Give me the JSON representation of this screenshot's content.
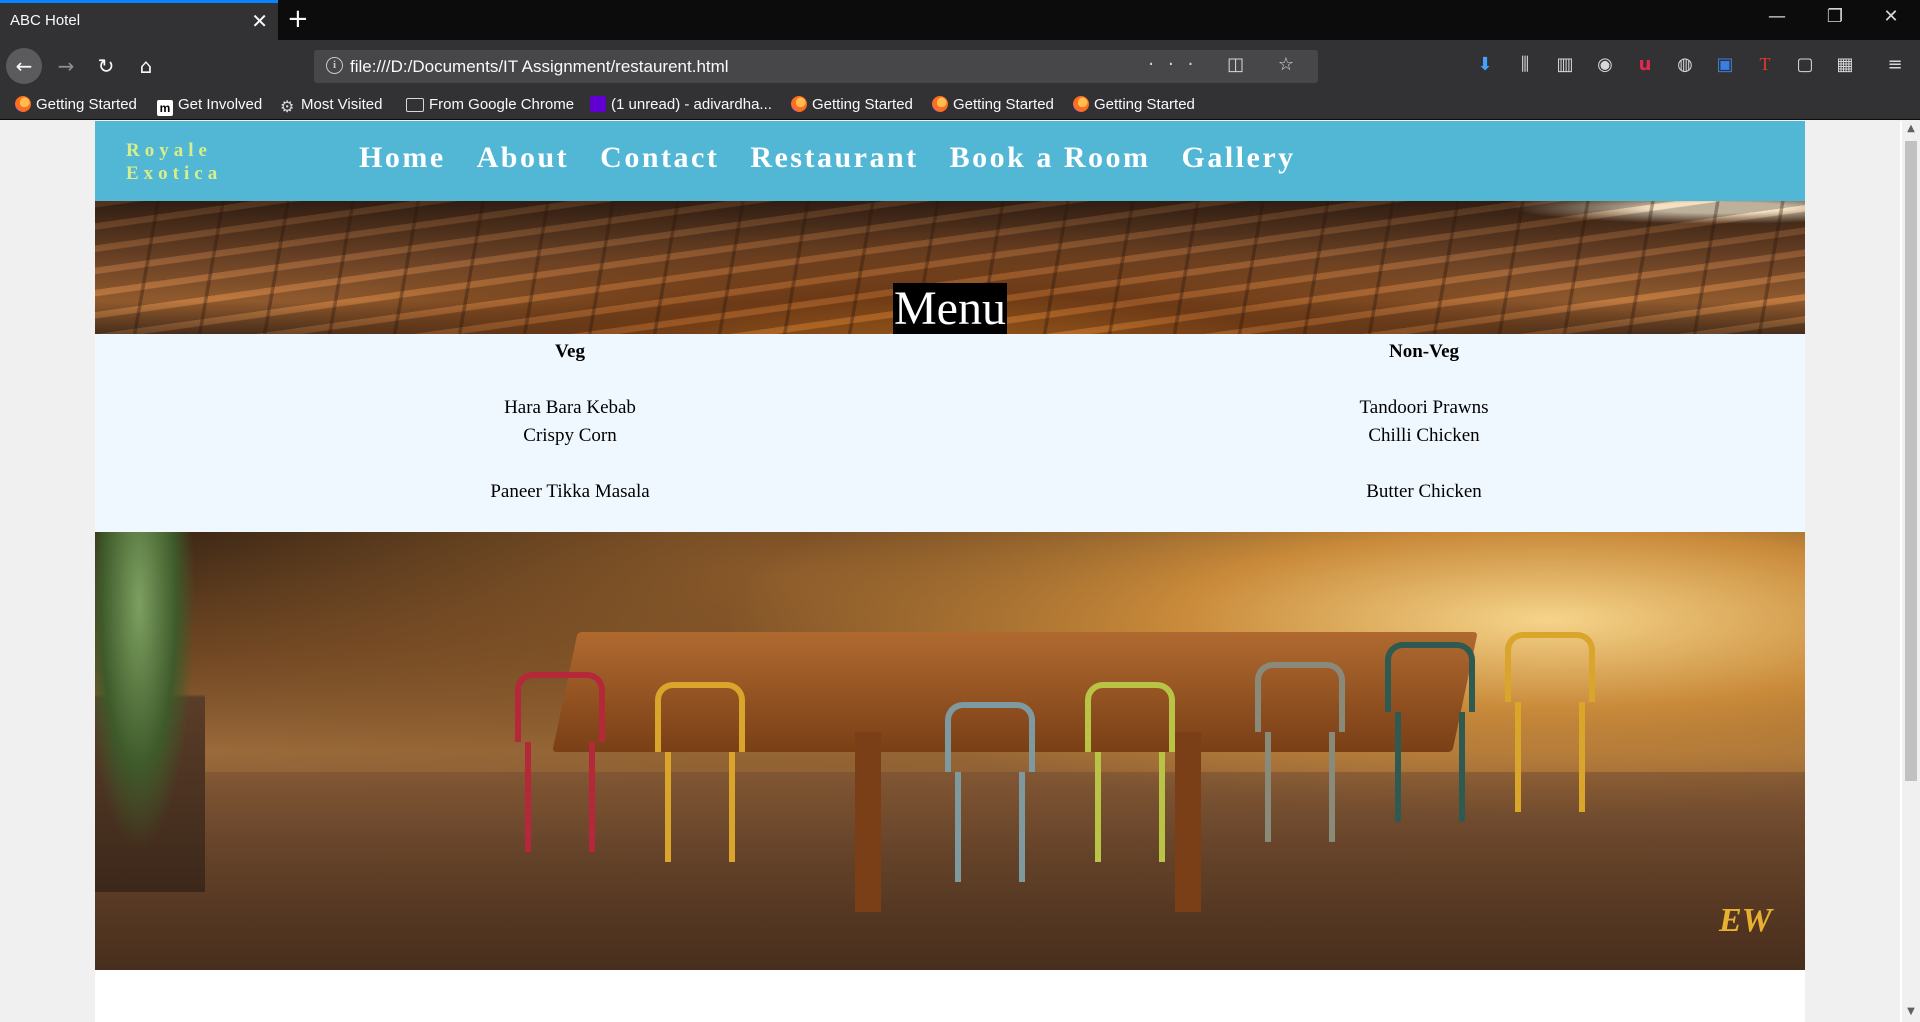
{
  "browser": {
    "tab_title": "ABC Hotel",
    "tab_close": "✕",
    "new_tab": "+",
    "window_controls": [
      "—",
      "❐",
      "✕"
    ],
    "url": "file:///D:/Documents/IT Assignment/restaurent.html",
    "url_info_icon": "i",
    "url_actions": "··· ◫ ☆",
    "nav_glyphs": {
      "back": "←",
      "forward": "→",
      "reload": "↻",
      "home": "⌂"
    },
    "toolbar_glyphs": [
      "⬇",
      "⫼",
      "▥",
      "◉",
      "u",
      "◍",
      "▣",
      "T",
      "▢",
      "▦",
      "≡"
    ],
    "bookmarks": [
      "Getting Started",
      "Get Involved",
      "Most Visited",
      "From Google Chrome",
      "(1 unread) - adivardha...",
      "Getting Started",
      "Getting Started",
      "Getting Started"
    ],
    "bookmark_icons": [
      "m",
      "⚙"
    ]
  },
  "site": {
    "logo_line1": "Royale",
    "logo_line2": "Exotica",
    "logo_color": "#d8ee8a",
    "header_color": "#52b6d5",
    "nav": [
      "Home",
      "About",
      "Contact",
      "Restaurant",
      "Book a Room",
      "Gallery"
    ],
    "hero_title": "Menu",
    "menu": {
      "veg": {
        "heading": "Veg",
        "items": [
          "Hara Bara Kebab",
          "Crispy Corn",
          "Paneer Tikka Masala"
        ]
      },
      "nonveg": {
        "heading": "Non-Veg",
        "items": [
          "Tandoori Prawns",
          "Chilli Chicken",
          "Butter Chicken"
        ]
      }
    },
    "watermark_text": "EW"
  },
  "scrollbar": {
    "up": "▲",
    "down": "▼"
  }
}
